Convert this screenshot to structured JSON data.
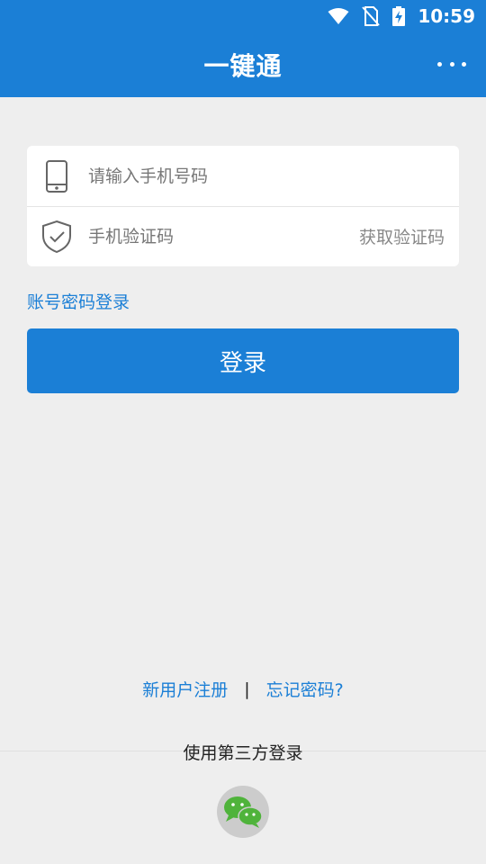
{
  "status_bar": {
    "time": "10:59"
  },
  "app_bar": {
    "title": "一键通"
  },
  "form": {
    "phone_placeholder": "请输入手机号码",
    "code_placeholder": "手机验证码",
    "get_code_label": "获取验证码"
  },
  "account_login_label": "账号密码登录",
  "login_button_label": "登录",
  "bottom_links": {
    "register_label": "新用户注册",
    "separator": "|",
    "forgot_label": "忘记密码?"
  },
  "third_party": {
    "label": "使用第三方登录",
    "icon": "wechat-icon"
  },
  "colors": {
    "primary": "#1b7fd6",
    "background": "#eeeeee",
    "wechat_green": "#4fb33b"
  }
}
